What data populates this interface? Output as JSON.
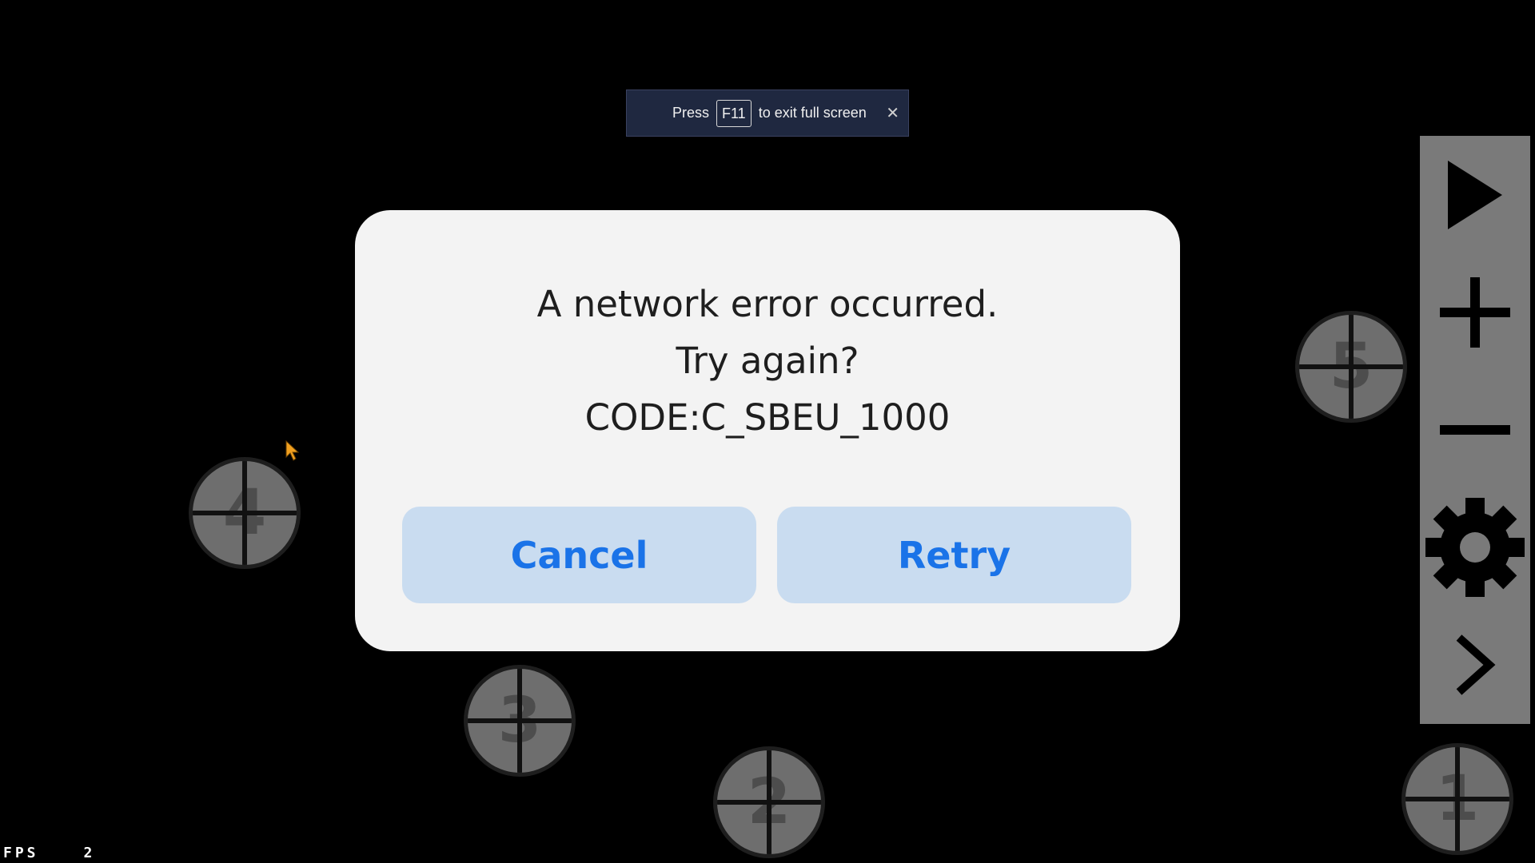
{
  "fullscreen_toast": {
    "press_label": "Press",
    "key_label": "F11",
    "exit_label": "to exit full screen",
    "close_glyph": "✕"
  },
  "dialog": {
    "line1": "A network error occurred.",
    "line2": "Try again?",
    "line3": "CODE:C_SBEU_1000",
    "cancel_label": "Cancel",
    "retry_label": "Retry",
    "accent_color": "#1a73e8",
    "button_bg": "#c9dcf0"
  },
  "markers": [
    {
      "label": "1"
    },
    {
      "label": "2"
    },
    {
      "label": "3"
    },
    {
      "label": "4"
    },
    {
      "label": "5"
    }
  ],
  "toolbar": {
    "items": [
      {
        "icon": "play-icon"
      },
      {
        "icon": "plus-icon"
      },
      {
        "icon": "minus-icon"
      },
      {
        "icon": "gear-icon"
      },
      {
        "icon": "chevron-right-icon"
      }
    ]
  },
  "fps": {
    "label": "FPS",
    "value": "2"
  }
}
